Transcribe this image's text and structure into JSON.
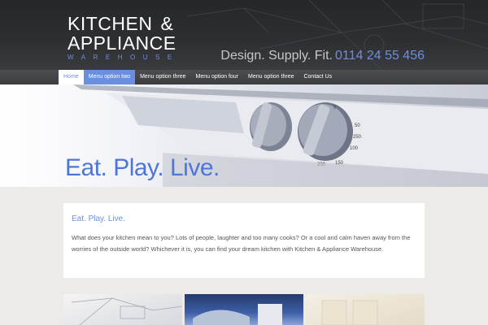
{
  "header": {
    "logo": {
      "line1": "KITCHEN",
      "amp": "&",
      "line2": "APPLIANCE",
      "line3": "WAREHOUSE"
    },
    "tagline": "Design. Supply. Fit.",
    "phone": "0114 24 55 456"
  },
  "nav": {
    "items": [
      {
        "label": "Home"
      },
      {
        "label": "Menu option two"
      },
      {
        "label": "Menu option three"
      },
      {
        "label": "Menu option four"
      },
      {
        "label": "Menu option three"
      },
      {
        "label": "Contact Us"
      }
    ]
  },
  "hero": {
    "title": "Eat. Play. Live.",
    "dial_numbers": [
      "0",
      "50",
      "100",
      "150",
      "200",
      "250"
    ]
  },
  "content": {
    "title": "Eat. Play. Live.",
    "text": "What does your kitchen mean to you? Lots of people, laughter and too many cooks? Or a cool and calm haven away from the worries of the outside world? Whichever it is, you can find your dream kitchen with Kitchen & Appliance Warehouse."
  },
  "colors": {
    "accent": "#6b8fe0",
    "header_bg": "#2b2c30",
    "nav_bg": "#444548",
    "page_bg": "#ecebe7"
  }
}
